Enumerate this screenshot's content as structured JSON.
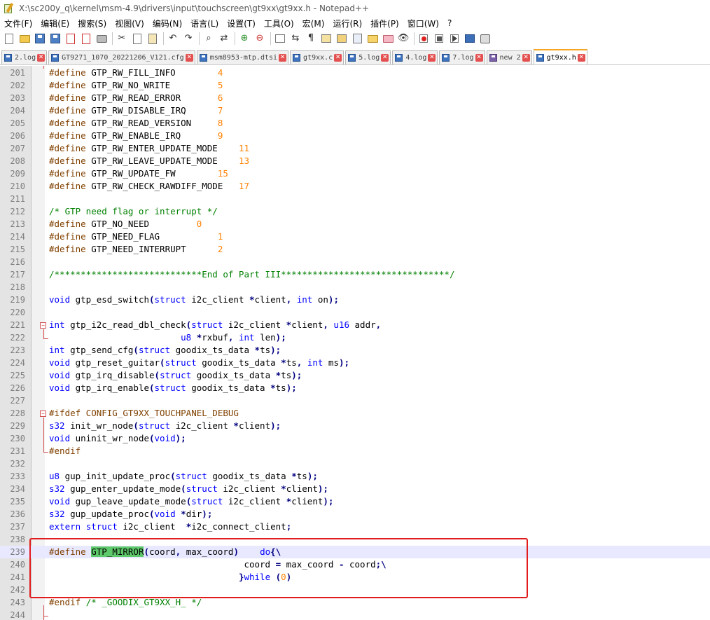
{
  "window": {
    "title": "X:\\sc200y_q\\kernel\\msm-4.9\\drivers\\input\\touchscreen\\gt9xx\\gt9xx.h - Notepad++"
  },
  "menu": [
    "文件(F)",
    "编辑(E)",
    "搜索(S)",
    "视图(V)",
    "编码(N)",
    "语言(L)",
    "设置(T)",
    "工具(O)",
    "宏(M)",
    "运行(R)",
    "插件(P)",
    "窗口(W)",
    "?"
  ],
  "toolbar": {
    "icons": [
      "new-file",
      "open-file",
      "save",
      "save-all",
      "close",
      "close-all",
      "print",
      "cut",
      "copy",
      "paste",
      "undo",
      "redo",
      "find",
      "replace",
      "zoom-in",
      "zoom-out",
      "sync-vertical",
      "word-wrap",
      "show-all-chars",
      "indent-guide",
      "function-list",
      "document-map",
      "folder-workspace",
      "monitor",
      "record-macro",
      "stop-recording",
      "play-macro",
      "run-macro-multiple",
      "save-macro"
    ]
  },
  "tabs": [
    {
      "label": "2.log",
      "color": "blue",
      "active": false
    },
    {
      "label": "GT9271_1070_20221206_V121.cfg",
      "color": "blue",
      "active": false
    },
    {
      "label": "msm8953-mtp.dtsi",
      "color": "blue",
      "active": false
    },
    {
      "label": "gt9xx.c",
      "color": "blue",
      "active": false
    },
    {
      "label": "5.log",
      "color": "blue",
      "active": false
    },
    {
      "label": "4.log",
      "color": "blue",
      "active": false
    },
    {
      "label": "7.log",
      "color": "blue",
      "active": false
    },
    {
      "label": "new 2",
      "color": "purple",
      "active": false
    },
    {
      "label": "gt9xx.h",
      "color": "blue",
      "active": true
    }
  ],
  "editor": {
    "current_line": 239,
    "lines": [
      {
        "n": "201",
        "code": "#define GTP_RW_FILL_INFO        4"
      },
      {
        "n": "202",
        "code": "#define GTP_RW_NO_WRITE         5"
      },
      {
        "n": "203",
        "code": "#define GTP_RW_READ_ERROR       6"
      },
      {
        "n": "204",
        "code": "#define GTP_RW_DISABLE_IRQ      7"
      },
      {
        "n": "205",
        "code": "#define GTP_RW_READ_VERSION     8"
      },
      {
        "n": "206",
        "code": "#define GTP_RW_ENABLE_IRQ       9"
      },
      {
        "n": "207",
        "code": "#define GTP_RW_ENTER_UPDATE_MODE    11"
      },
      {
        "n": "208",
        "code": "#define GTP_RW_LEAVE_UPDATE_MODE    13"
      },
      {
        "n": "209",
        "code": "#define GTP_RW_UPDATE_FW        15"
      },
      {
        "n": "210",
        "code": "#define GTP_RW_CHECK_RAWDIFF_MODE   17"
      },
      {
        "n": "211",
        "code": ""
      },
      {
        "n": "212",
        "code": "/* GTP need flag or interrupt */"
      },
      {
        "n": "213",
        "code": "#define GTP_NO_NEED         0"
      },
      {
        "n": "214",
        "code": "#define GTP_NEED_FLAG           1"
      },
      {
        "n": "215",
        "code": "#define GTP_NEED_INTERRUPT      2"
      },
      {
        "n": "216",
        "code": ""
      },
      {
        "n": "217",
        "code": "/****************************End of Part III********************************/"
      },
      {
        "n": "218",
        "code": ""
      },
      {
        "n": "219",
        "code": "void gtp_esd_switch(struct i2c_client *client, int on);"
      },
      {
        "n": "220",
        "code": ""
      },
      {
        "n": "221",
        "code": "int gtp_i2c_read_dbl_check(struct i2c_client *client, u16 addr,"
      },
      {
        "n": "222",
        "code": "                         u8 *rxbuf, int len);"
      },
      {
        "n": "223",
        "code": "int gtp_send_cfg(struct goodix_ts_data *ts);"
      },
      {
        "n": "224",
        "code": "void gtp_reset_guitar(struct goodix_ts_data *ts, int ms);"
      },
      {
        "n": "225",
        "code": "void gtp_irq_disable(struct goodix_ts_data *ts);"
      },
      {
        "n": "226",
        "code": "void gtp_irq_enable(struct goodix_ts_data *ts);"
      },
      {
        "n": "227",
        "code": ""
      },
      {
        "n": "228",
        "code": "#ifdef CONFIG_GT9XX_TOUCHPANEL_DEBUG"
      },
      {
        "n": "229",
        "code": "s32 init_wr_node(struct i2c_client *client);"
      },
      {
        "n": "230",
        "code": "void uninit_wr_node(void);"
      },
      {
        "n": "231",
        "code": "#endif"
      },
      {
        "n": "232",
        "code": ""
      },
      {
        "n": "233",
        "code": "u8 gup_init_update_proc(struct goodix_ts_data *ts);"
      },
      {
        "n": "234",
        "code": "s32 gup_enter_update_mode(struct i2c_client *client);"
      },
      {
        "n": "235",
        "code": "void gup_leave_update_mode(struct i2c_client *client);"
      },
      {
        "n": "236",
        "code": "s32 gup_update_proc(void *dir);"
      },
      {
        "n": "237",
        "code": "extern struct i2c_client  *i2c_connect_client;"
      },
      {
        "n": "238",
        "code": ""
      },
      {
        "n": "239",
        "code": "#define GTP_MIRROR(coord, max_coord)    do{\\"
      },
      {
        "n": "240",
        "code": "                                     coord = max_coord - coord;\\"
      },
      {
        "n": "241",
        "code": "                                    }while (0)"
      },
      {
        "n": "242",
        "code": ""
      },
      {
        "n": "243",
        "code": "#endif /* _GOODIX_GT9XX_H_ */"
      },
      {
        "n": "244",
        "code": ""
      }
    ],
    "highlighted_word": "GTP_MIRROR",
    "annotation_color": "#e21c1c"
  }
}
